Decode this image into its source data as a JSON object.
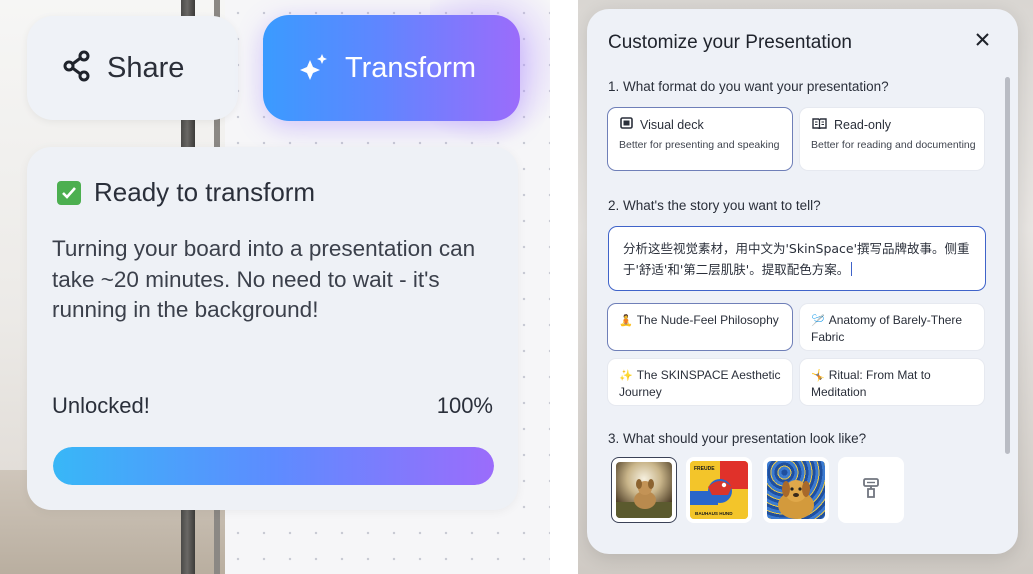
{
  "left": {
    "share_label": "Share",
    "transform_label": "Transform",
    "status_title": "Ready to transform",
    "status_body": "Turning your board into a presentation can take ~20 minutes. No need to wait - it's running in the background!",
    "unlocked_label": "Unlocked!",
    "progress_text": "100%",
    "progress_value": 1.0,
    "colors": {
      "accent_start": "#38b7f7",
      "accent_end": "#9b6cfb",
      "check": "#4caf50"
    }
  },
  "modal": {
    "title": "Customize your Presentation",
    "q1": "1. What format do you want your presentation?",
    "formats": [
      {
        "icon": "slides-icon",
        "title": "Visual deck",
        "desc": "Better for presenting and speaking",
        "selected": true
      },
      {
        "icon": "book-icon",
        "title": "Read-only",
        "desc": "Better for reading and documenting",
        "selected": false
      }
    ],
    "q2": "2. What's the story you want to tell?",
    "story_input": "分析这些视觉素材，用中文为'SkinSpace'撰写品牌故事。侧重于'舒适'和'第二层肌肤'。提取配色方案。",
    "stories": [
      {
        "emoji": "🧘",
        "text": "The Nude-Feel Philosophy",
        "selected": true
      },
      {
        "emoji": "🪡",
        "text": "Anatomy of Barely-There Fabric",
        "selected": false
      },
      {
        "emoji": "✨",
        "text": "The SKINSPACE Aesthetic Journey",
        "selected": false
      },
      {
        "emoji": "🤸",
        "text": "Ritual: From Mat to Meditation",
        "selected": false
      }
    ],
    "q3": "3. What should your presentation look like?",
    "styles": [
      {
        "name": "photo-dog-style",
        "selected": true
      },
      {
        "name": "bauhaus-style",
        "texts": [
          "FREUDE",
          "BAUHAUS HUND"
        ],
        "selected": false
      },
      {
        "name": "van-gogh-dog-style",
        "selected": false
      },
      {
        "name": "custom-style",
        "icon": "paint-roller-icon",
        "selected": false
      }
    ]
  }
}
